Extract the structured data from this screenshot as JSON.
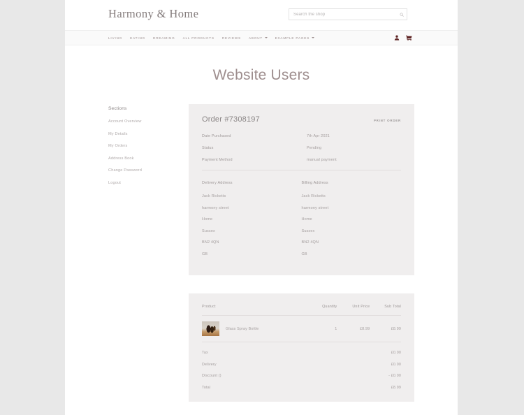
{
  "header": {
    "logo": "Harmony & Home",
    "search": {
      "placeholder": "Search the shop",
      "value": "",
      "icon": "search-icon"
    },
    "icons": [
      {
        "name": "account-icon",
        "glyph": "user"
      },
      {
        "name": "cart-icon",
        "glyph": "cart"
      }
    ]
  },
  "nav": {
    "items": [
      {
        "label": "LIVING",
        "has_dropdown": false
      },
      {
        "label": "EATING",
        "has_dropdown": false
      },
      {
        "label": "DREAMING",
        "has_dropdown": false
      },
      {
        "label": "ALL PRODUCTS",
        "has_dropdown": false
      },
      {
        "label": "REVIEWS",
        "has_dropdown": false
      },
      {
        "label": "ABOUT",
        "has_dropdown": true
      },
      {
        "label": "EXAMPLE PAGES",
        "has_dropdown": true
      }
    ]
  },
  "page": {
    "title": "Website Users"
  },
  "sidebar": {
    "title": "Sections",
    "items": [
      {
        "label": "Account Overview"
      },
      {
        "label": "My Details"
      },
      {
        "label": "My Orders"
      },
      {
        "label": "Address Book"
      },
      {
        "label": "Change Password"
      },
      {
        "label": "Logout"
      }
    ]
  },
  "order": {
    "number": "Order #7308197",
    "print_label": "PRINT ORDER",
    "meta": [
      {
        "label": "Date Purchased",
        "value": "7th Apr 2021"
      },
      {
        "label": "Status",
        "value": "Pending"
      },
      {
        "label": "Payment Method",
        "value": "manual payment"
      }
    ],
    "delivery_address": {
      "title": "Delivery Address",
      "lines": [
        "Jack Ricketts",
        "harmony street",
        "Home",
        "Sussex",
        "BN2 4QN",
        "GB"
      ]
    },
    "billing_address": {
      "title": "Billing Address",
      "lines": [
        "Jack Ricketts",
        "harmony street",
        "Home",
        "Sussex",
        "BN2 4QN",
        "GB"
      ]
    }
  },
  "products": {
    "columns": [
      "Product",
      "Quantity",
      "Unit Price",
      "Sub Total"
    ],
    "rows": [
      {
        "name": "Glass Spray Bottle",
        "quantity": "1",
        "unit_price": "£8.99",
        "sub_total": "£8.99",
        "thumbnail": "glass-spray-bottle-photo"
      }
    ],
    "totals": [
      {
        "label": "Tax",
        "value": "£0.00"
      },
      {
        "label": "Delivery",
        "value": "£0.00"
      },
      {
        "label": "Discount ()",
        "value": "- £0.00"
      },
      {
        "label": "Total",
        "value": "£8.99"
      }
    ]
  },
  "colors": {
    "page_background": "#e8e8e8",
    "site_background": "#ffffff",
    "card_background": "#f0eeee",
    "accent_icon": "#5e2424",
    "title_text": "#9e8e8e",
    "body_text": "#a39d9d"
  }
}
